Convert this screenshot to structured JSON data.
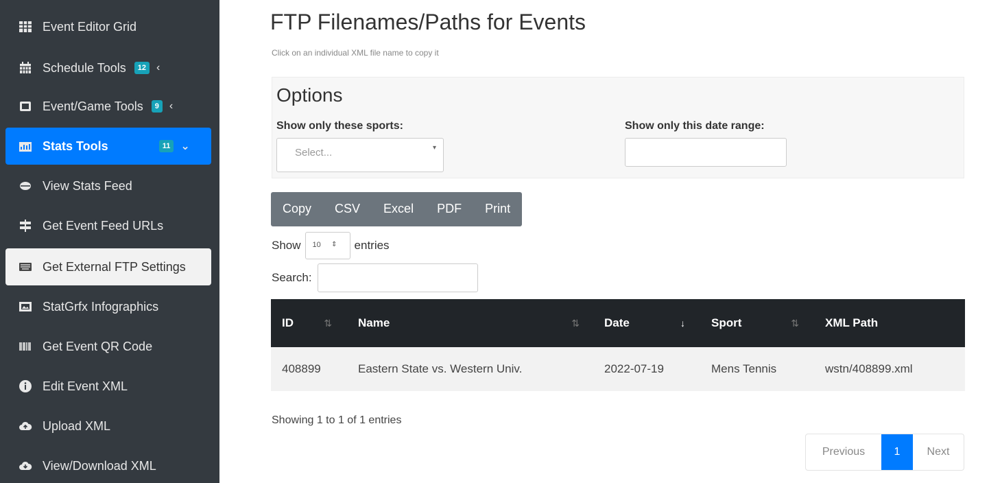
{
  "sidebar": {
    "items": [
      {
        "label": "Event Editor Grid",
        "icon": "grid-icon"
      },
      {
        "label": "Schedule Tools",
        "icon": "calendar-icon",
        "badge": "12",
        "chevron": "‹"
      },
      {
        "label": "Event/Game Tools",
        "icon": "gamepad-icon",
        "badge": "9",
        "chevron": "‹"
      },
      {
        "label": "Stats Tools",
        "icon": "stats-icon",
        "badge": "11",
        "chevron": "⌄",
        "state": "active"
      },
      {
        "label": "View Stats Feed",
        "icon": "feed-icon"
      },
      {
        "label": "Get Event Feed URLs",
        "icon": "signs-icon"
      },
      {
        "label": "Get External FTP Settings",
        "icon": "keyboard-icon",
        "state": "selected"
      },
      {
        "label": "StatGrfx Infographics",
        "icon": "image-icon"
      },
      {
        "label": "Get Event QR Code",
        "icon": "barcode-icon"
      },
      {
        "label": "Edit Event XML",
        "icon": "info-icon"
      },
      {
        "label": "Upload XML",
        "icon": "cloud-upload-icon"
      },
      {
        "label": "View/Download XML",
        "icon": "cloud-download-icon"
      }
    ]
  },
  "main": {
    "title": "FTP Filenames/Paths for Events",
    "subtitle": "Click on an individual XML file name to copy it",
    "options": {
      "title": "Options",
      "sports_label": "Show only these sports:",
      "sports_placeholder": "Select...",
      "date_label": "Show only this date range:",
      "date_value": ""
    },
    "buttons": [
      "Copy",
      "CSV",
      "Excel",
      "PDF",
      "Print"
    ],
    "length": {
      "show": "Show",
      "value": "10",
      "entries": "entries"
    },
    "search": {
      "label": "Search:",
      "value": ""
    },
    "table": {
      "columns": [
        "ID",
        "Name",
        "Date",
        "Sport",
        "XML Path"
      ],
      "rows": [
        [
          "408899",
          "Eastern State vs. Western Univ.",
          "2022-07-19",
          "Mens Tennis",
          "wstn/408899.xml"
        ]
      ]
    },
    "info": "Showing 1 to 1 of 1 entries",
    "pagination": {
      "previous": "Previous",
      "current": "1",
      "next": "Next"
    }
  },
  "colors": {
    "sidebar_bg": "#343a40",
    "active": "#007bff",
    "badge": "#17a2b8",
    "table_header": "#212529"
  }
}
